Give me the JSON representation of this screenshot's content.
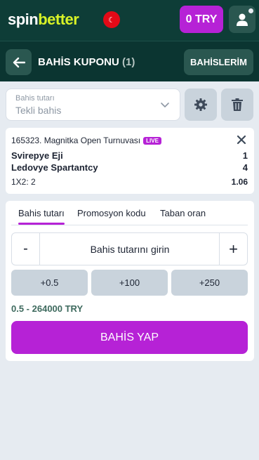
{
  "header": {
    "logo_part1": "spin",
    "logo_part2": "better",
    "flag_icon": "turkey-flag-icon",
    "balance": "0 TRY",
    "user_icon": "user-icon"
  },
  "subheader": {
    "back_icon": "arrow-left-icon",
    "title": "BAHİS KUPONU",
    "count": "(1)",
    "my_bets": "BAHİSLERİM"
  },
  "bet_type_select": {
    "label": "Bahis tutarı",
    "value": "Tekli bahis"
  },
  "event": {
    "title": "165323. Magnitka Open Turnuvası",
    "live_badge": "LIVE",
    "team1": "Svirepye Eji",
    "team1_score": "1",
    "team2": "Ledovye Spartantcy",
    "team2_score": "4",
    "bet_type": "1X2: 2",
    "odds": "1.06"
  },
  "stake": {
    "tabs": [
      {
        "label": "Bahis tutarı",
        "active": true
      },
      {
        "label": "Promosyon kodu",
        "active": false
      },
      {
        "label": "Taban oran",
        "active": false
      }
    ],
    "minus": "-",
    "plus": "+",
    "placeholder": "Bahis tutarını girin",
    "quick_amounts": [
      "+0.5",
      "+100",
      "+250"
    ],
    "range": "0.5 - 264000 TRY",
    "place_bet": "BAHİS YAP"
  },
  "colors": {
    "accent": "#b622d6",
    "header_bg": "#0e3d37",
    "logo_accent": "#d8f227",
    "page_bg": "#e6ebf1"
  }
}
